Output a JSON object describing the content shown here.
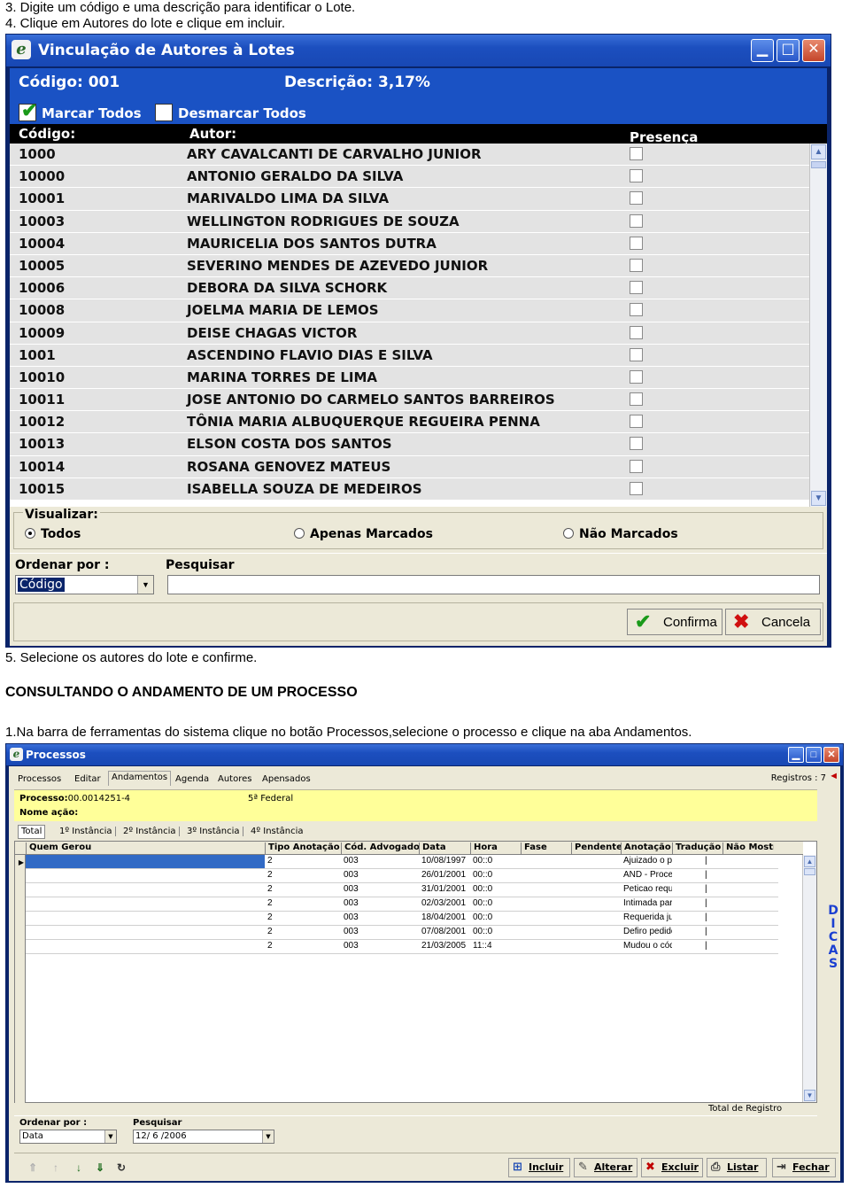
{
  "doc": {
    "step3": "3. Digite um código e uma descrição para identificar o Lote.",
    "step4": "4. Clique em Autores do lote e clique em incluir.",
    "step5": "5. Selecione os autores do lote e confirme.",
    "heading": "CONSULTANDO O ANDAMENTO DE UM PROCESSO",
    "step1b": "1.Na barra de ferramentas do sistema clique no botão Processos,selecione o processo e clique na aba Andamentos."
  },
  "win1": {
    "title": "Vinculação de Autores à Lotes",
    "codigo": "Código: 001",
    "descricao": "Descrição: 3,17%",
    "marcar_todos": "Marcar Todos",
    "desmarcar_todos": "Desmarcar Todos",
    "col_codigo": "Código:",
    "col_autor": "Autor:",
    "col_presenca": "Presença",
    "rows": [
      {
        "code": "1000",
        "author": "ARY CAVALCANTI DE CARVALHO JUNIOR"
      },
      {
        "code": "10000",
        "author": "ANTONIO GERALDO DA SILVA"
      },
      {
        "code": "10001",
        "author": "MARIVALDO LIMA DA SILVA"
      },
      {
        "code": "10003",
        "author": "WELLINGTON RODRIGUES DE SOUZA"
      },
      {
        "code": "10004",
        "author": "MAURICELIA DOS SANTOS DUTRA"
      },
      {
        "code": "10005",
        "author": "SEVERINO MENDES DE AZEVEDO JUNIOR"
      },
      {
        "code": "10006",
        "author": "DEBORA DA SILVA SCHORK"
      },
      {
        "code": "10008",
        "author": "JOELMA MARIA DE LEMOS"
      },
      {
        "code": "10009",
        "author": "DEISE CHAGAS VICTOR"
      },
      {
        "code": "1001",
        "author": "ASCENDINO FLAVIO DIAS E SILVA"
      },
      {
        "code": "10010",
        "author": "MARINA TORRES DE LIMA"
      },
      {
        "code": "10011",
        "author": "JOSE ANTONIO DO CARMELO SANTOS BARREIROS"
      },
      {
        "code": "10012",
        "author": "TÔNIA MARIA ALBUQUERQUE REGUEIRA PENNA"
      },
      {
        "code": "10013",
        "author": "ELSON COSTA DOS SANTOS"
      },
      {
        "code": "10014",
        "author": "ROSANA GENOVEZ MATEUS"
      },
      {
        "code": "10015",
        "author": "ISABELLA SOUZA DE MEDEIROS"
      }
    ],
    "visualizar": "Visualizar:",
    "radio_todos": "Todos",
    "radio_marcados": "Apenas Marcados",
    "radio_nao": "Não Marcados",
    "ordenar_label": "Ordenar por :",
    "ordenar_value": "Código",
    "pesquisar_label": "Pesquisar",
    "pesquisar_value": "",
    "confirma": "Confirma",
    "cancela": "Cancela"
  },
  "win2": {
    "title": "Processos",
    "tabs": [
      "Processos",
      "Editar",
      "Andamentos",
      "Agenda",
      "Autores",
      "Apensados"
    ],
    "registros": "Registros : 7",
    "processo_label": "Processo:",
    "processo_value": "00.0014251-4",
    "vara": "5ª Federal",
    "nome_acao": "Nome ação:",
    "inst_tabs": [
      "Total",
      "1º Instância",
      "2º Instância",
      "3º Instância",
      "4º Instância"
    ],
    "columns": [
      "Quem Gerou",
      "Tipo Anotação",
      "Cód. Advogado",
      "Data",
      "Hora",
      "Fase",
      "Pendente",
      "Anotação",
      "Tradução",
      "Não Mostra"
    ],
    "rows": [
      {
        "tipo": "2",
        "adv": "003",
        "data": "10/08/1997",
        "hora": "00::0",
        "anot": "Ajuizado o pro"
      },
      {
        "tipo": "2",
        "adv": "003",
        "data": "26/01/2001",
        "hora": "00::0",
        "anot": "AND - Proces"
      },
      {
        "tipo": "2",
        "adv": "003",
        "data": "31/01/2001",
        "hora": "00::0",
        "anot": "Peticao reque"
      },
      {
        "tipo": "2",
        "adv": "003",
        "data": "02/03/2001",
        "hora": "00::0",
        "anot": "Intimada parte"
      },
      {
        "tipo": "2",
        "adv": "003",
        "data": "18/04/2001",
        "hora": "00::0",
        "anot": "Requerida jur"
      },
      {
        "tipo": "2",
        "adv": "003",
        "data": "07/08/2001",
        "hora": "00::0",
        "anot": "Defiro pedido"
      },
      {
        "tipo": "2",
        "adv": "003",
        "data": "21/03/2005",
        "hora": "11::4",
        "anot": "Mudou o cód"
      }
    ],
    "total_registro": "Total de Registro",
    "dicas": "DICAS",
    "ordenar_label": "Ordenar por :",
    "ordenar_value": "Data",
    "pesquisar_label": "Pesquisar",
    "pesquisar_value": "12/ 6 /2006",
    "btn_incluir": "Incluir",
    "btn_alterar": "Alterar",
    "btn_excluir": "Excluir",
    "btn_listar": "Listar",
    "btn_fechar": "Fechar"
  }
}
